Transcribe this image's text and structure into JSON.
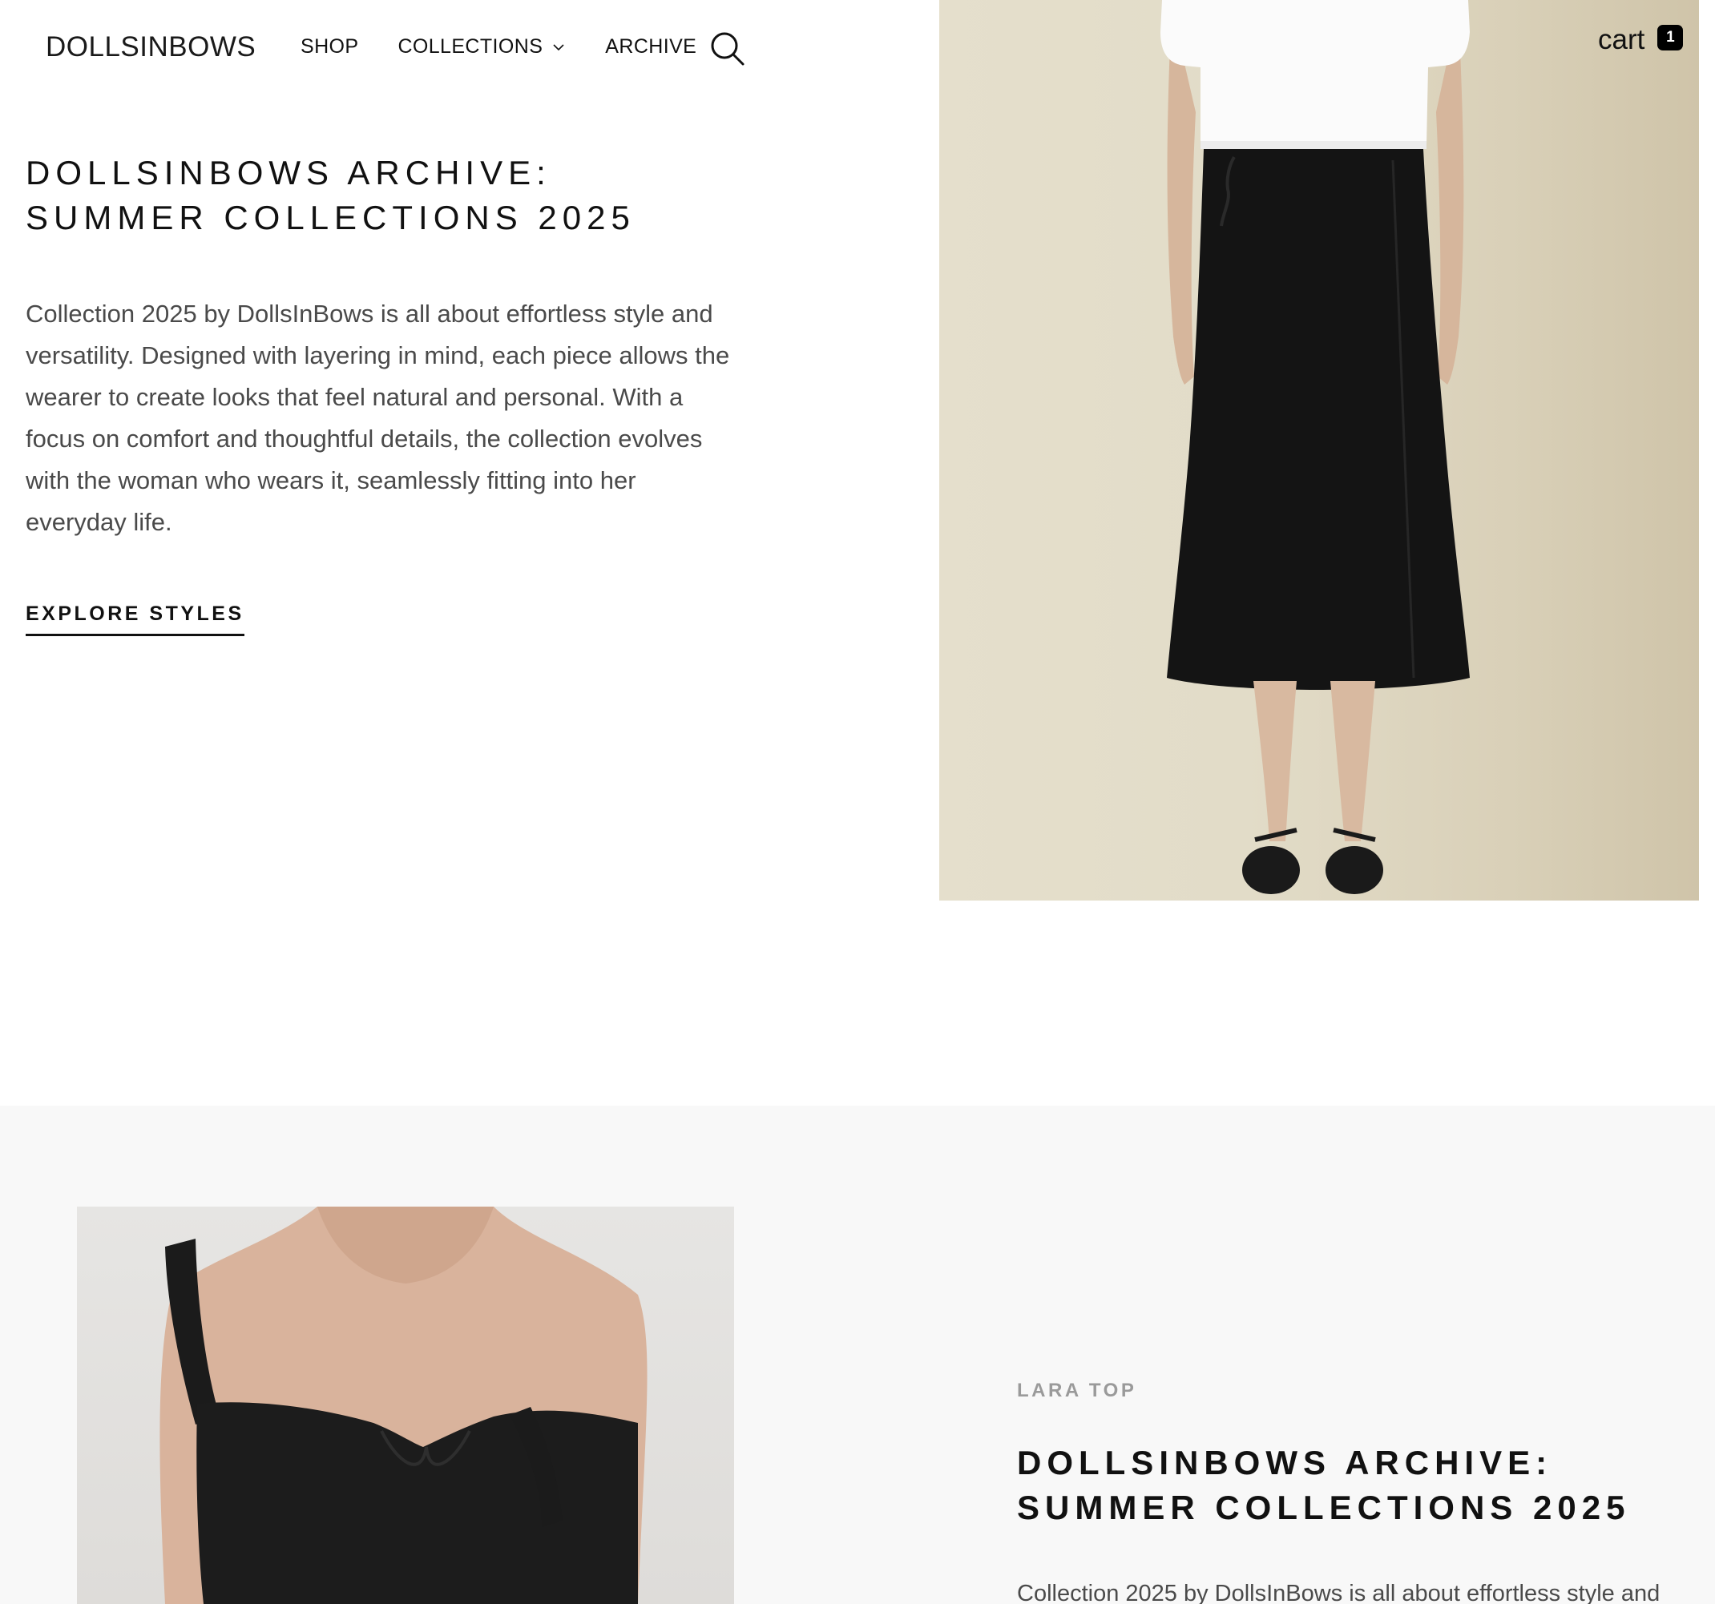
{
  "header": {
    "logo": "DOLLSINBOWS",
    "nav": [
      {
        "label": "SHOP"
      },
      {
        "label": "COLLECTIONS"
      },
      {
        "label": "ARCHIVE"
      }
    ]
  },
  "cart": {
    "label": "cart",
    "count": "1"
  },
  "hero": {
    "title": "DOLLSINBOWS ARCHIVE: SUMMER COLLECTIONS 2025",
    "body": "Collection 2025 by DollsInBows is all about effortless style and versatility. Designed with layering in mind, each piece allows the wearer to create looks that feel natural and personal. With a focus on comfort and thoughtful details, the collection evolves with the woman who wears it, seamlessly fitting into her everyday life.",
    "cta": "EXPLORE STYLES"
  },
  "feature": {
    "eyebrow": "LARA TOP",
    "title": "DOLLSINBOWS ARCHIVE: SUMMER COLLECTIONS 2025",
    "body": "Collection 2025 by DollsInBows is all about effortless style and"
  },
  "colors": {
    "text": "#111111",
    "muted": "#4a4a4a",
    "eyebrow": "#9a9a9a",
    "section_bg": "#f8f8f8",
    "badge_bg": "#000000"
  },
  "icons": {
    "search": "search-icon",
    "chevron": "chevron-down-icon"
  }
}
